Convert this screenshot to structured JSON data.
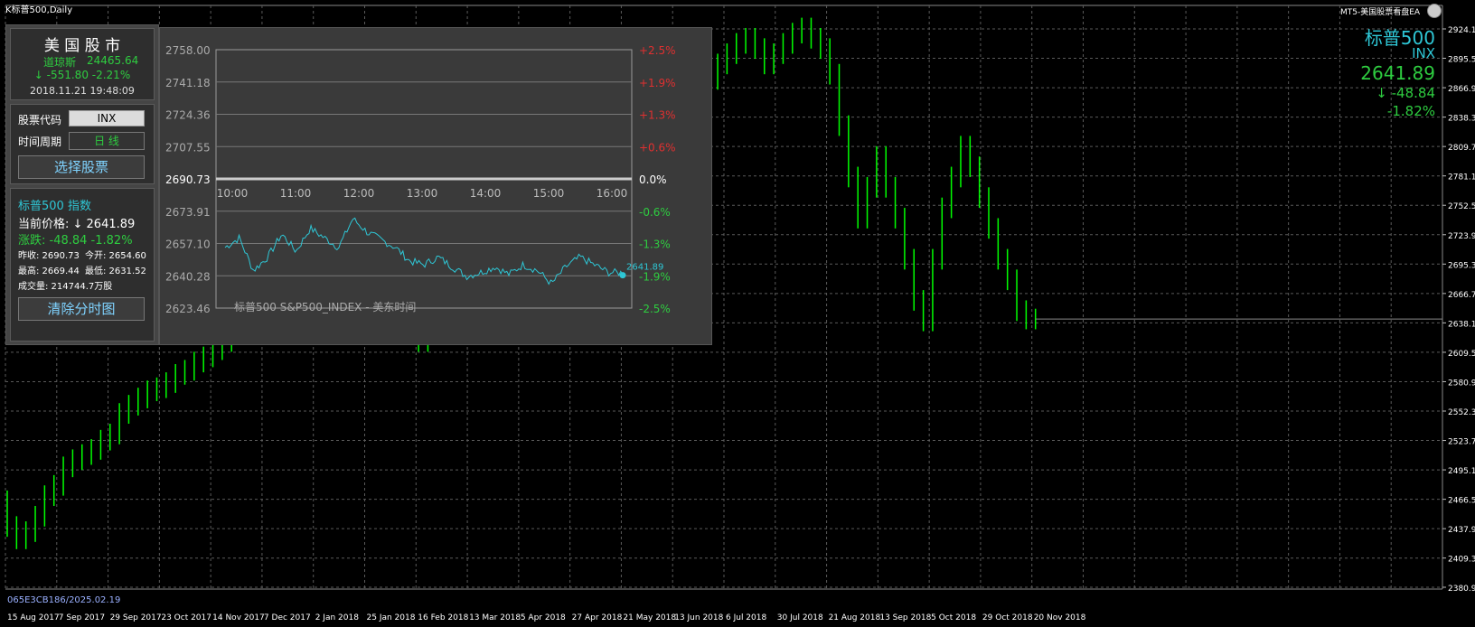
{
  "window": {
    "title": "K标普500,Daily",
    "ea_label": "MT5-美国股票看盘EA"
  },
  "watermark": "065E3CB186/2025.02.19",
  "right_info": {
    "name": "标普500",
    "code": "INX",
    "price": "2641.89",
    "change": "↓ -48.84",
    "pct": "-1.82%"
  },
  "market_box": {
    "title": "美 国 股 市",
    "dow_label": "道琼斯",
    "dow_value": "24465.64",
    "dow_change": "↓  -551.80  -2.21%",
    "datetime": "2018.11.21 19:48:09"
  },
  "settings": {
    "code_label": "股票代码",
    "code_value": "INX",
    "period_label": "时间周期",
    "period_value": "日 线",
    "select_button": "选择股票"
  },
  "quote": {
    "title": "标普500 指数",
    "price_label": "当前价格: ↓ 2641.89",
    "change_label": "涨跌: -48.84  -1.82%",
    "prev": "昨收: 2690.73",
    "open": "今开: 2654.60",
    "high": "最高: 2669.44",
    "low": "最低: 2631.52",
    "volume": "成交量: 214744.7万股",
    "clear_button": "清除分时图"
  },
  "intraday": {
    "caption": "标普500 S&P500_INDEX - 美东时间",
    "left_ticks": [
      "2758.00",
      "2741.18",
      "2724.36",
      "2707.55",
      "2690.73",
      "2673.91",
      "2657.10",
      "2640.28",
      "2623.46"
    ],
    "right_ticks": [
      "+2.5%",
      "+1.9%",
      "+1.3%",
      "+0.6%",
      "0.0%",
      "-0.6%",
      "-1.3%",
      "-1.9%",
      "-2.5%"
    ],
    "times": [
      "10:00",
      "11:00",
      "12:00",
      "13:00",
      "14:00",
      "15:00",
      "16:00"
    ],
    "last_label": "2641.89",
    "colors": {
      "up": "#e03030",
      "down": "#2ecc40",
      "line": "#2ec7d6"
    }
  },
  "chart_data": {
    "type": "line",
    "title": "K标普500,Daily",
    "y_axis": {
      "min": 2380.9,
      "max": 2924.1,
      "ticks": [
        "2924.10",
        "2895.55",
        "2866.90",
        "2838.30",
        "2809.70",
        "2781.10",
        "2752.50",
        "2723.90",
        "2695.30",
        "2666.70",
        "2638.10",
        "2609.50",
        "2580.90",
        "2552.30",
        "2523.70",
        "2495.10",
        "2466.50",
        "2437.90",
        "2409.30",
        "2380.90"
      ]
    },
    "x_axis": {
      "ticks": [
        "15 Aug 2017",
        "7 Sep 2017",
        "29 Sep 2017",
        "23 Oct 2017",
        "14 Nov 2017",
        "7 Dec 2017",
        "2 Jan 2018",
        "25 Jan 2018",
        "16 Feb 2018",
        "13 Mar 2018",
        "5 Apr 2018",
        "27 Apr 2018",
        "21 May 2018",
        "13 Jun 2018",
        "6 Jul 2018",
        "30 Jul 2018",
        "21 Aug 2018",
        "13 Sep 2018",
        "5 Oct 2018",
        "29 Oct 2018",
        "20 Nov 2018"
      ]
    },
    "series": [
      {
        "values": [
          2465,
          2440,
          2428,
          2435,
          2450,
          2470,
          2480,
          2498,
          2505,
          2510,
          2515,
          2524,
          2530,
          2550,
          2558,
          2565,
          2572,
          2575,
          2580,
          2588,
          2592,
          2600,
          2605,
          2612,
          2620,
          2628,
          2640,
          2660,
          2680,
          2700,
          2700,
          2720,
          2740,
          2760,
          2790,
          2840,
          2870,
          2760,
          2650,
          2700,
          2720,
          2740,
          2700,
          2660,
          2640,
          2620,
          2650,
          2680,
          2665,
          2670,
          2630,
          2650,
          2690,
          2700,
          2720,
          2725,
          2750,
          2760,
          2780,
          2770,
          2755,
          2740,
          2720,
          2700,
          2710,
          2730,
          2760,
          2790,
          2800,
          2810,
          2820,
          2815,
          2830,
          2845,
          2850,
          2860,
          2875,
          2890,
          2900,
          2910,
          2915,
          2905,
          2890,
          2900,
          2910,
          2920,
          2925,
          2915,
          2905,
          2880,
          2830,
          2780,
          2740,
          2770,
          2800,
          2770,
          2740,
          2700,
          2660,
          2640,
          2700,
          2750,
          2780,
          2810,
          2790,
          2760,
          2730,
          2700,
          2680,
          2650,
          2641.89
        ]
      }
    ],
    "last_price": "2641.89",
    "colors": {
      "candle": "#00ff00",
      "grid": "#5a5a5a"
    },
    "grid": true
  }
}
